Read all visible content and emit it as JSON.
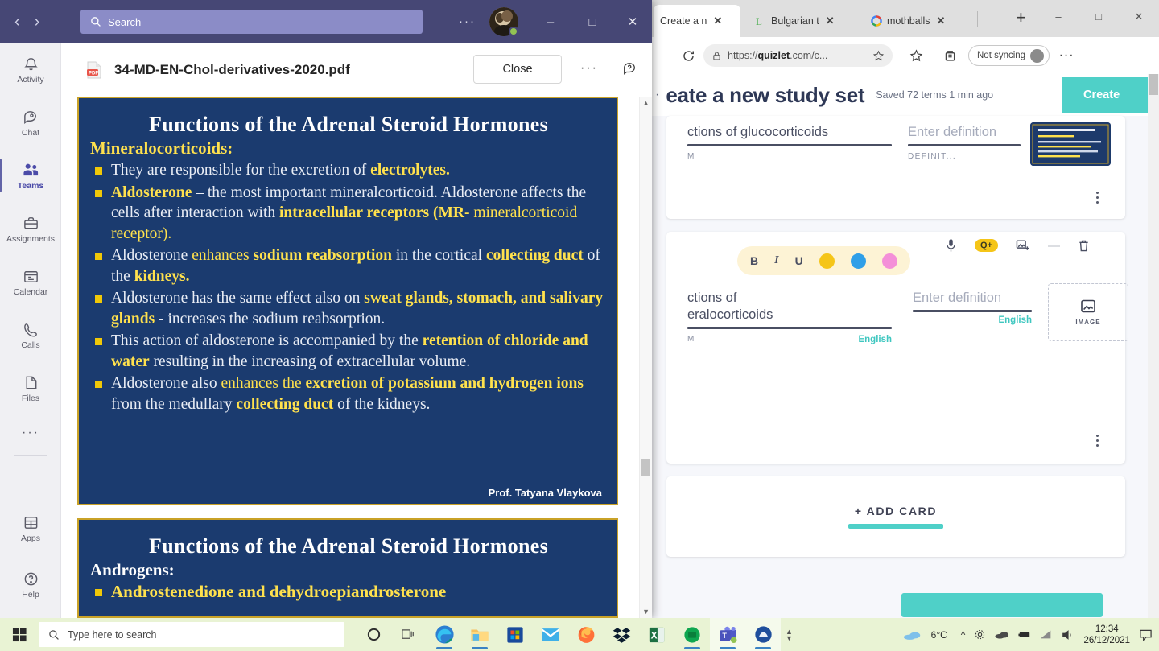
{
  "edge": {
    "tabs": [
      {
        "title": "Create a n",
        "favicon": "quizlet-icon",
        "active": true
      },
      {
        "title": "Bulgarian t",
        "favicon": "lingvo-l-icon",
        "active": false
      },
      {
        "title": "mothballs",
        "favicon": "google-icon",
        "active": false
      }
    ],
    "new_tab_label": "+",
    "window_controls": {
      "minimize": "–",
      "maximize": "□",
      "close": "✕"
    },
    "toolbar": {
      "reload_label": "⟳",
      "url_prefix": "https://",
      "url_domain": "quizlet",
      "url_suffix": ".com/c...",
      "sync_label": "Not syncing",
      "more_label": "···"
    }
  },
  "quizlet": {
    "title": "eate a new study set",
    "saved_status": "Saved 72 terms 1 min ago",
    "create_button": "Create",
    "cards": [
      {
        "term_value": "ctions of glucocorticoids",
        "term_sub": "M",
        "definition_placeholder": "Enter definition",
        "definition_sub": "DEFINIT...",
        "has_thumbnail": true
      },
      {
        "term_value_line1": "ctions of",
        "term_value_line2": "eralocorticoids",
        "term_lang": "English",
        "term_sub": "M",
        "definition_placeholder": "Enter definition",
        "definition_lang": "English",
        "image_button_label": "IMAGE"
      }
    ],
    "format_toolbar": {
      "bold": "B",
      "italic": "I",
      "underline": "U",
      "highlight_yellow": "#f5c518",
      "highlight_blue": "#2f9fe8",
      "highlight_pink": "#f48fd8",
      "mic_icon": "microphone-icon",
      "quizlet_badge": "Q+",
      "add_image_icon": "add-image-icon",
      "minus_icon": "—",
      "delete_icon": "trash-icon"
    },
    "add_card_label": "+ ADD CARD",
    "accent_color": "#4fd0c8"
  },
  "teams": {
    "titlebar": {
      "back_arrow": "‹",
      "forward_arrow": "›",
      "search_placeholder": "Search",
      "more_label": "···",
      "minimize": "–",
      "maximize": "□",
      "close": "✕"
    },
    "rail": [
      {
        "label": "Activity",
        "icon": "bell-icon",
        "active": false
      },
      {
        "label": "Chat",
        "icon": "chat-icon",
        "active": false
      },
      {
        "label": "Teams",
        "icon": "teams-people-icon",
        "active": true
      },
      {
        "label": "Assignments",
        "icon": "assignments-bag-icon",
        "active": false
      },
      {
        "label": "Calendar",
        "icon": "calendar-icon",
        "active": false
      },
      {
        "label": "Calls",
        "icon": "phone-icon",
        "active": false
      },
      {
        "label": "Files",
        "icon": "file-icon",
        "active": false
      },
      {
        "label": "···",
        "icon": "more-apps-icon",
        "active": false
      }
    ],
    "rail_bottom": [
      {
        "label": "Apps",
        "icon": "apps-grid-icon"
      },
      {
        "label": "Help",
        "icon": "help-question-icon"
      }
    ],
    "pdf_viewer": {
      "file_name": "34-MD-EN-Chol-derivatives-2020.pdf",
      "file_icon": "pdf-file-icon",
      "close_button": "Close",
      "more_options": "···",
      "feedback_icon": "feedback-icon"
    }
  },
  "slides": [
    {
      "title": "Functions of the Adrenal Steroid Hormones",
      "subtitle": "Mineralocorticoids:",
      "subtitle_color": "#ffe14d",
      "author": "Prof. Tatyana Vlaykova",
      "bullets": [
        [
          {
            "t": "They are responsible for  the excretion of ",
            "s": "plain"
          },
          {
            "t": "electrolytes.",
            "s": "yb"
          }
        ],
        [
          {
            "t": "Aldosterone",
            "s": "yb"
          },
          {
            "t": " – the most important mineralcorticoid. Aldosterone affects the cells after  interaction with ",
            "s": "plain"
          },
          {
            "t": "intracellular receptors (MR-",
            "s": "yb"
          },
          {
            "t": " mineralcorticoid receptor).",
            "s": "y"
          }
        ],
        [
          {
            "t": "Aldosterone ",
            "s": "plain"
          },
          {
            "t": "enhances ",
            "s": "y"
          },
          {
            "t": "sodium reabsorption",
            "s": "yb"
          },
          {
            "t": " in the cortical ",
            "s": "plain"
          },
          {
            "t": "collecting duct",
            "s": "yb"
          },
          {
            "t": " of the ",
            "s": "plain"
          },
          {
            "t": "kidneys.",
            "s": "yb"
          }
        ],
        [
          {
            "t": "Aldosterone has the same effect also on ",
            "s": "plain"
          },
          {
            "t": "sweat glands, stomach, and salivary glands",
            "s": "yb"
          },
          {
            "t": " - increases the sodium reabsorption.",
            "s": "plain"
          }
        ],
        [
          {
            "t": "This action of aldosterone is accompanied by the ",
            "s": "plain"
          },
          {
            "t": "retention of chloride and water",
            "s": "yb"
          },
          {
            "t": " resulting in the increasing of extracellular volume.",
            "s": "plain"
          }
        ],
        [
          {
            "t": "Aldosterone also ",
            "s": "plain"
          },
          {
            "t": "enhances the ",
            "s": "y"
          },
          {
            "t": "excretion of potassium and hydrogen ions",
            "s": "yb"
          },
          {
            "t": " from the medullary ",
            "s": "plain"
          },
          {
            "t": "collecting duct",
            "s": "yb"
          },
          {
            "t": " of the kidneys.",
            "s": "plain"
          }
        ]
      ]
    },
    {
      "title": "Functions of the Adrenal Steroid Hormones",
      "subtitle": "Androgens:",
      "subtitle_color": "#ffffff",
      "author": "",
      "bullets": [
        [
          {
            "t": "Androstenedione",
            "s": "yb"
          },
          {
            "t": " and ",
            "s": "y"
          },
          {
            "t": "dehydroepiandrosterone",
            "s": "yb"
          }
        ]
      ]
    }
  ],
  "taskbar": {
    "start_icon": "windows-start-icon",
    "search_placeholder": "Type here to search",
    "search_icon": "search-icon",
    "pinned": [
      {
        "name": "cortana-icon"
      },
      {
        "name": "task-view-icon"
      },
      {
        "name": "edge-icon"
      },
      {
        "name": "file-explorer-icon"
      },
      {
        "name": "microsoft-store-icon"
      },
      {
        "name": "mail-icon"
      },
      {
        "name": "firefox-icon"
      },
      {
        "name": "dropbox-icon"
      },
      {
        "name": "excel-icon"
      },
      {
        "name": "green-app-icon"
      },
      {
        "name": "teams-icon"
      },
      {
        "name": "blue-circle-app-icon"
      }
    ],
    "tray": {
      "weather_icon": "cloud-icon",
      "temperature": "6°C",
      "chevron": "^",
      "icons": [
        "settings-gear-icon",
        "onedrive-cloud-icon",
        "usb-icon",
        "network-icon",
        "volume-icon"
      ],
      "time": "12:34",
      "date": "26/12/2021",
      "notification_icon": "notifications-icon"
    }
  }
}
